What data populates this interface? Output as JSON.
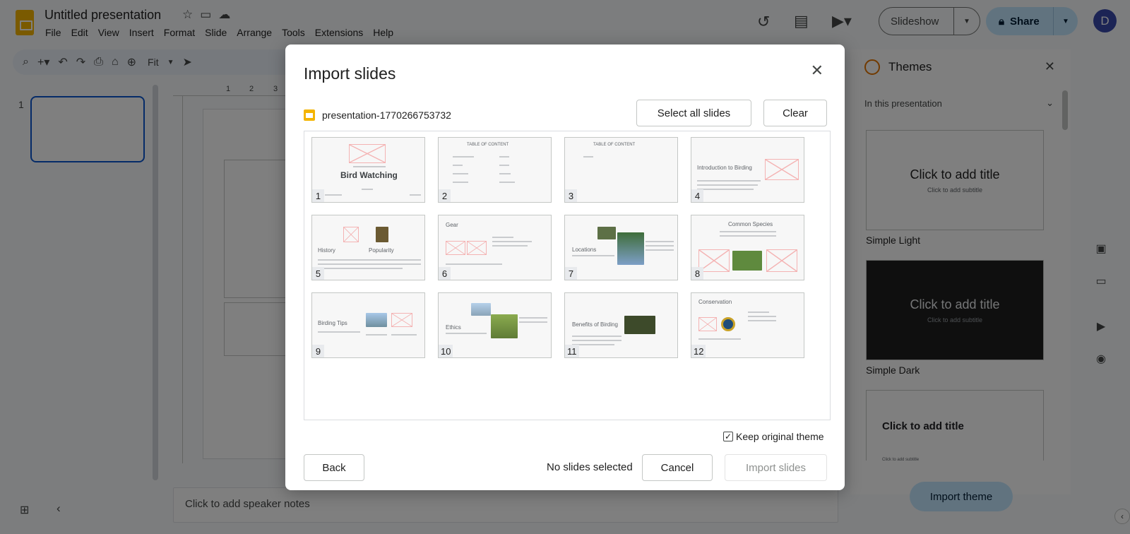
{
  "app": {
    "doc_title": "Untitled presentation",
    "menu": [
      "File",
      "Edit",
      "View",
      "Insert",
      "Format",
      "Slide",
      "Arrange",
      "Tools",
      "Extensions",
      "Help"
    ],
    "slideshow_label": "Slideshow",
    "share_label": "Share",
    "avatar_initial": "D",
    "zoom": "Fit"
  },
  "filmstrip": {
    "slide_number": "1"
  },
  "ruler": {
    "h_ticks": [
      "1",
      "2",
      "3"
    ]
  },
  "notes": {
    "placeholder": "Click to add speaker notes"
  },
  "themes": {
    "title": "Themes",
    "filter": "In this presentation",
    "cards": [
      {
        "name": "Simple Light",
        "title": "Click to add title",
        "subtitle": "Click to add subtitle"
      },
      {
        "name": "Simple Dark",
        "title": "Click to add title",
        "subtitle": "Click to add subtitle"
      },
      {
        "name": "",
        "title": "Click to add title",
        "subtitle": "Click to add subtitle"
      }
    ],
    "import_label": "Import theme"
  },
  "dialog": {
    "title": "Import slides",
    "file_name": "presentation-1770266753732",
    "select_all_label": "Select all slides",
    "clear_label": "Clear",
    "keep_theme_label": "Keep original theme",
    "keep_theme_checked": true,
    "back_label": "Back",
    "status": "No slides selected",
    "cancel_label": "Cancel",
    "import_label": "Import slides",
    "slides": [
      {
        "num": "1",
        "title": "Bird Watching"
      },
      {
        "num": "2",
        "title": "TABLE OF CONTENT"
      },
      {
        "num": "3",
        "title": "TABLE OF CONTENT"
      },
      {
        "num": "4",
        "title": "Introduction to Birding"
      },
      {
        "num": "5",
        "title": "History",
        "title2": "Popularity"
      },
      {
        "num": "6",
        "title": "Gear"
      },
      {
        "num": "7",
        "title": "Locations"
      },
      {
        "num": "8",
        "title": "Common Species"
      },
      {
        "num": "9",
        "title": "Birding Tips"
      },
      {
        "num": "10",
        "title": "Ethics"
      },
      {
        "num": "11",
        "title": "Benefits of Birding"
      },
      {
        "num": "12",
        "title": "Conservation"
      }
    ]
  }
}
